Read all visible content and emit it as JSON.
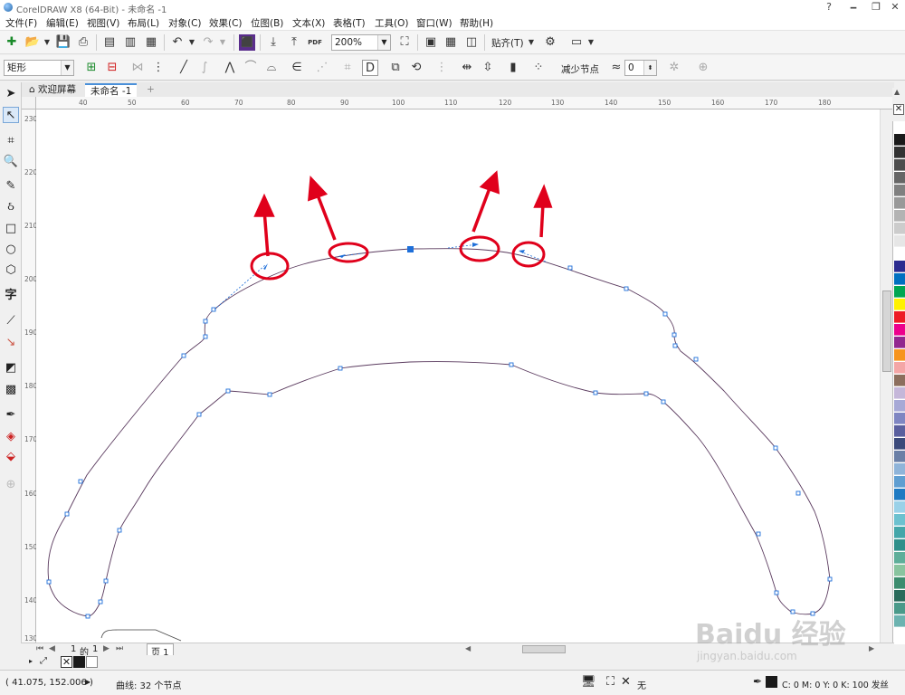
{
  "window": {
    "title": "CorelDRAW X8 (64-Bit) - 未命名 -1",
    "controls": [
      "?",
      "🗕",
      "❐",
      "✕"
    ]
  },
  "menu": [
    "文件(F)",
    "编辑(E)",
    "视图(V)",
    "布局(L)",
    "对象(C)",
    "效果(C)",
    "位图(B)",
    "文本(X)",
    "表格(T)",
    "工具(O)",
    "窗口(W)",
    "帮助(H)"
  ],
  "toolbar": {
    "zoom": "200%",
    "snap_label": "贴齐(T)",
    "pdf_label": "PDF"
  },
  "property_bar": {
    "shape_select": "矩形",
    "reduce_nodes_label": "减少节点",
    "smoothness_value": "0"
  },
  "tabs": {
    "home": "欢迎屏幕",
    "doc": "未命名 -1",
    "add": "+"
  },
  "ruler": {
    "h_labels": [
      "40",
      "50",
      "60",
      "70",
      "80",
      "90",
      "100",
      "110",
      "120",
      "130",
      "140",
      "150",
      "160",
      "170",
      "180"
    ],
    "v_labels": [
      "230",
      "220",
      "210",
      "200",
      "190",
      "180",
      "170",
      "160",
      "150",
      "140",
      "130"
    ]
  },
  "page_nav": {
    "current": "1",
    "of_label": "的",
    "total": "1",
    "page_tab": "页 1"
  },
  "status": {
    "coords": "( 41.075, 152.006 )",
    "object_info": "曲线: 32 个节点",
    "fill_none": "无",
    "outline_info": "C: 0 M: 0 Y: 0 K: 100  发丝"
  },
  "palette_colors": [
    "#ffffff",
    "#1a1a1a",
    "#333333",
    "#4d4d4d",
    "#666666",
    "#808080",
    "#999999",
    "#b3b3b3",
    "#cccccc",
    "#e6e6e6",
    "#ffffff",
    "#2b2b8f",
    "#0070c0",
    "#00a651",
    "#fff200",
    "#ed1c24",
    "#ec008c",
    "#92278f",
    "#f7941d",
    "#f4a6a6",
    "#8c6e5d",
    "#c5b7d9",
    "#a7a9d6",
    "#7f86c2",
    "#5a5f9e",
    "#3b4a7a",
    "#6a7fa6",
    "#8fb4d9",
    "#5f9ed1",
    "#1f7ac2",
    "#9ad1e8",
    "#6cc1cf",
    "#44a6a9",
    "#2f8f8a",
    "#5fae9a",
    "#89c49f",
    "#3c8c6e",
    "#2a6b5b",
    "#4a9a8a",
    "#6cb3b0"
  ],
  "color_accent": {
    "annotation_red": "#e0001b",
    "node_blue": "#1e6fd9"
  },
  "watermark": {
    "brand": "Baidu 经验",
    "url": "jingyan.baidu.com"
  }
}
